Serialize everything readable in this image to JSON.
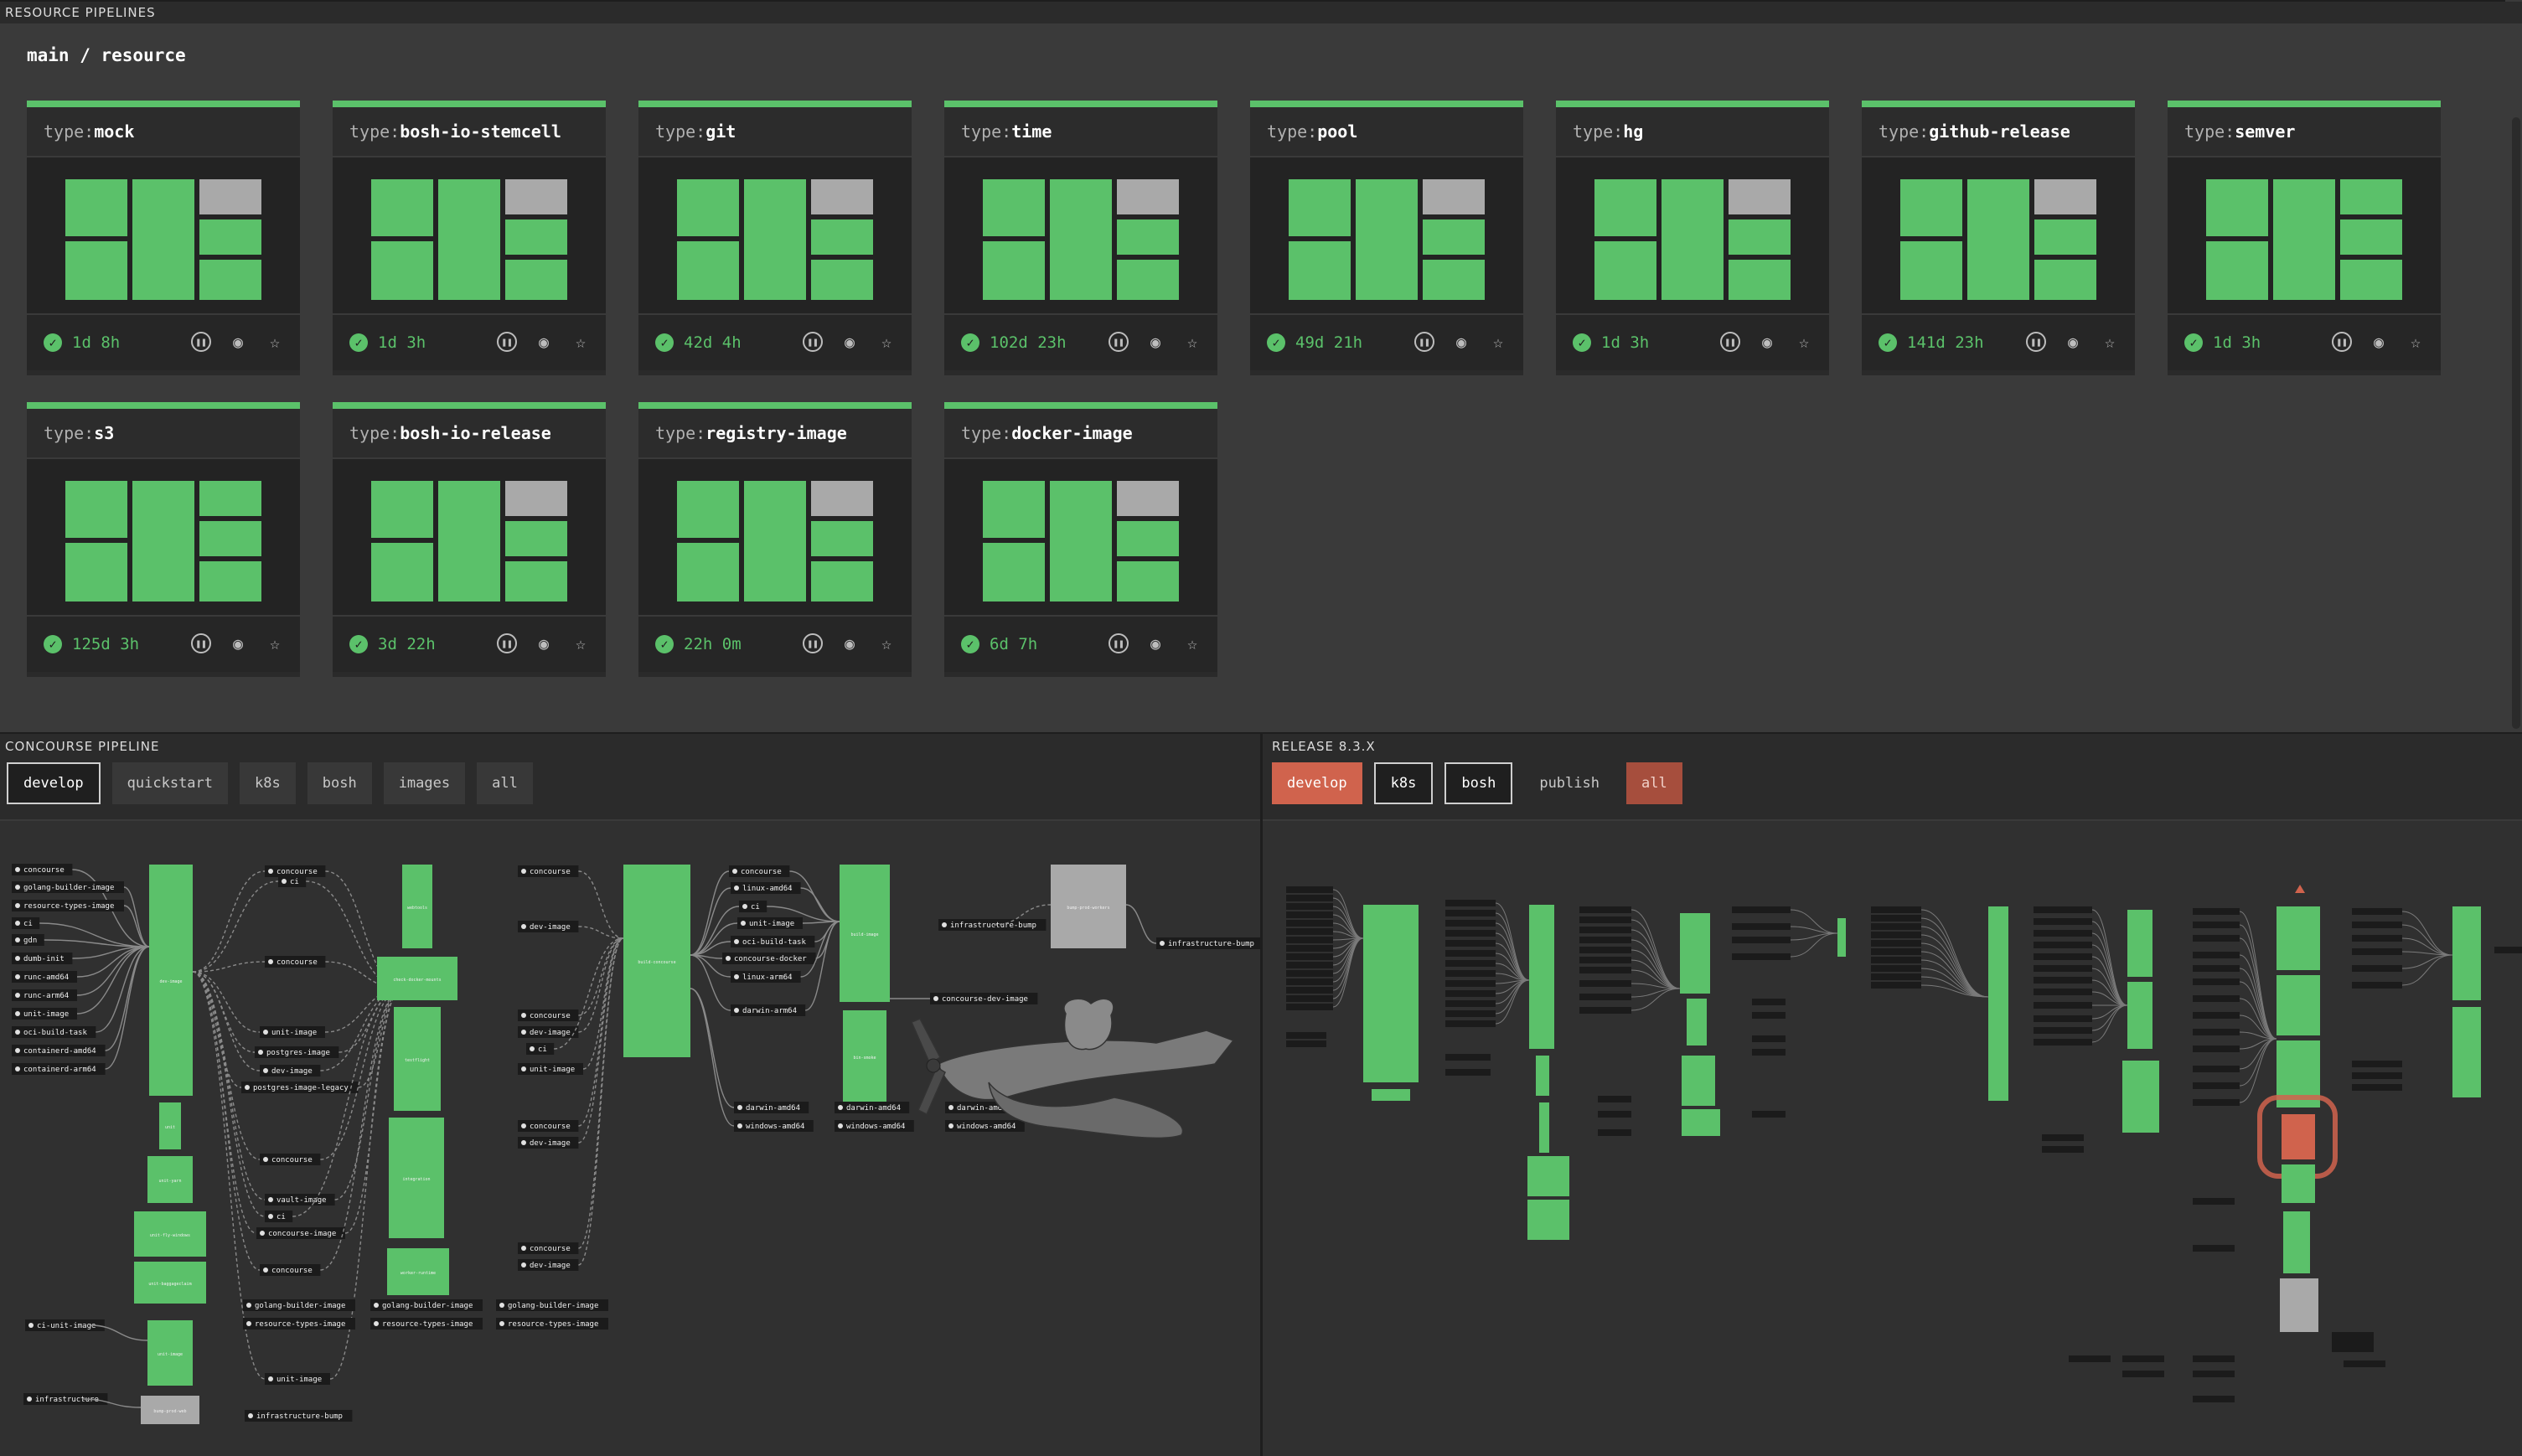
{
  "top": {
    "section_label": "RESOURCE PIPELINES",
    "breadcrumb": "main / resource"
  },
  "cards": [
    {
      "type_prefix": "type:",
      "name": "mock",
      "age": "1d 8h",
      "has_gray": true
    },
    {
      "type_prefix": "type:",
      "name": "bosh-io-stemcell",
      "age": "1d 3h",
      "has_gray": true
    },
    {
      "type_prefix": "type:",
      "name": "git",
      "age": "42d 4h",
      "has_gray": true
    },
    {
      "type_prefix": "type:",
      "name": "time",
      "age": "102d 23h",
      "has_gray": true
    },
    {
      "type_prefix": "type:",
      "name": "pool",
      "age": "49d 21h",
      "has_gray": true
    },
    {
      "type_prefix": "type:",
      "name": "hg",
      "age": "1d 3h",
      "has_gray": true
    },
    {
      "type_prefix": "type:",
      "name": "github-release",
      "age": "141d 23h",
      "has_gray": true
    },
    {
      "type_prefix": "type:",
      "name": "semver",
      "age": "1d 3h",
      "has_gray": false
    },
    {
      "type_prefix": "type:",
      "name": "s3",
      "age": "125d 3h",
      "has_gray": false
    },
    {
      "type_prefix": "type:",
      "name": "bosh-io-release",
      "age": "3d 22h",
      "has_gray": true
    },
    {
      "type_prefix": "type:",
      "name": "registry-image",
      "age": "22h 0m",
      "has_gray": true
    },
    {
      "type_prefix": "type:",
      "name": "docker-image",
      "age": "6d 7h",
      "has_gray": true
    }
  ],
  "concourse": {
    "section_label": "CONCOURSE PIPELINE",
    "tabs": [
      "develop",
      "quickstart",
      "k8s",
      "bosh",
      "images",
      "all"
    ],
    "selected_tab": "develop",
    "inputs": [
      "concourse",
      "golang-builder-image",
      "resource-types-image",
      "ci",
      "gdn",
      "dumb-init",
      "runc-amd64",
      "runc-arm64",
      "unit-image",
      "oci-build-task",
      "containerd-amd64",
      "containerd-arm64"
    ],
    "jobs": [
      "dev-image",
      "unit",
      "unit-yarn",
      "unit-fly-windows",
      "unit-baggageclaim",
      "unit-image",
      "bump-prod-web",
      "webtools",
      "check-docker-mounts",
      "testflight",
      "integration",
      "worker-runtime",
      "build-concourse",
      "build-image",
      "bin-smoke",
      "bump-prod-workers"
    ],
    "labels": [
      "concourse",
      "dev-image",
      "unit-image",
      "postgres-image",
      "postgres-image-legacy",
      "vault-image",
      "concourse-image",
      "ci-unit-image",
      "infrastructure",
      "infrastructure-bump",
      "linux-amd64",
      "oci-build-task",
      "concourse-docker",
      "linux-arm64",
      "darwin-arm64",
      "darwin-amd64",
      "windows-amd64",
      "concourse-dev-image",
      "golang-builder-image",
      "resource-types-image"
    ]
  },
  "release": {
    "section_label": "RELEASE 8.3.X",
    "tabs": [
      "develop",
      "k8s",
      "bosh",
      "publish",
      "all"
    ],
    "tab_styles": [
      "red",
      "outlined",
      "outlined",
      "plain",
      "red-dim"
    ]
  },
  "colors": {
    "success": "#5bc16a",
    "paused": "#a9a9a9",
    "error": "#d0634d",
    "bg": "#3a3a3a"
  }
}
